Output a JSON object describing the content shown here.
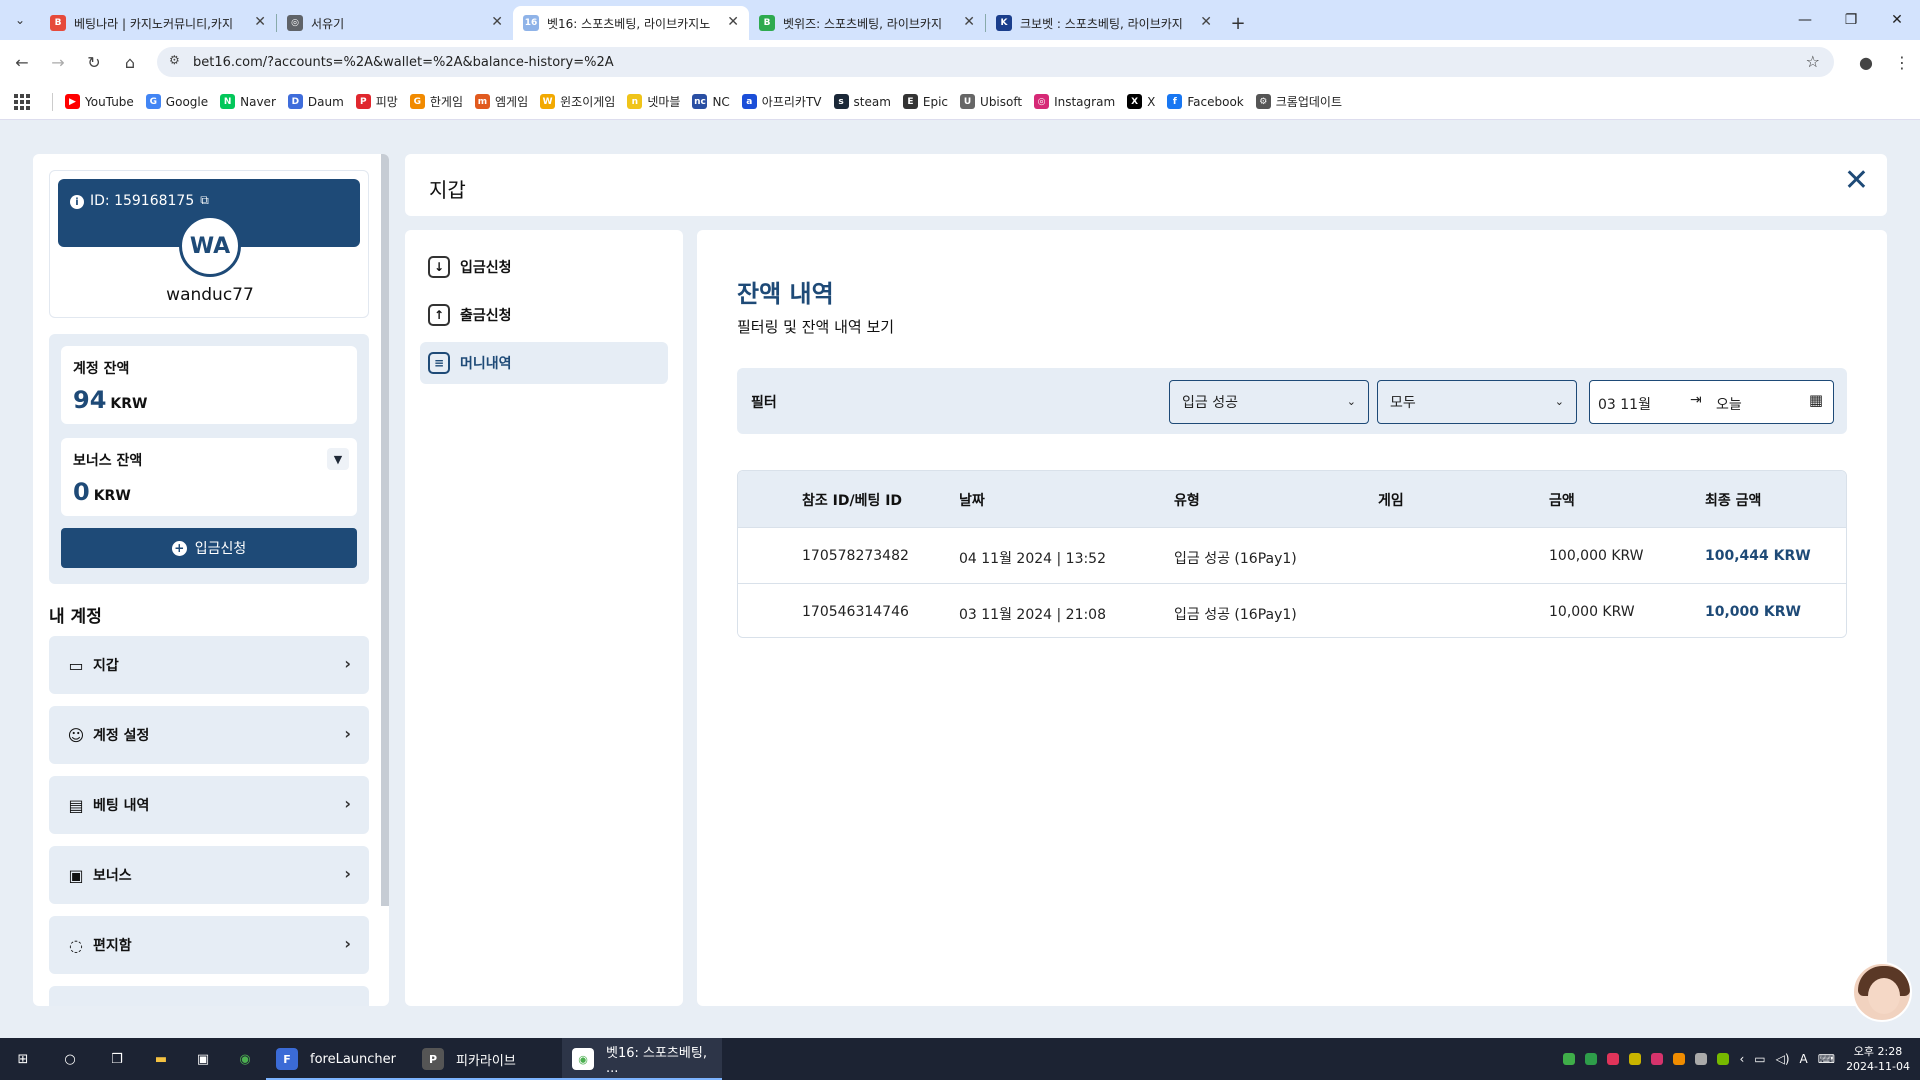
{
  "browser": {
    "tabs": [
      {
        "label": "베팅나라 | 카지노커뮤니티,카지",
        "fav": "B",
        "fav_color": "#e64a3b",
        "active": false
      },
      {
        "label": "서유기",
        "fav": "◎",
        "fav_color": "#5f6368",
        "active": false
      },
      {
        "label": "벳16: 스포츠베팅, 라이브카지노",
        "fav": "16",
        "fav_color": "#8fb3e8",
        "active": true
      },
      {
        "label": "벳위즈: 스포츠베팅, 라이브카지",
        "fav": "B",
        "fav_color": "#2eaa4f",
        "active": false
      },
      {
        "label": "크보벳 : 스포츠베팅, 라이브카지",
        "fav": "K",
        "fav_color": "#1a3e8c",
        "active": false
      }
    ],
    "url": "bet16.com/?accounts=%2A&wallet=%2A&balance-history=%2A",
    "bookmarks": [
      {
        "label": "YouTube",
        "icon": "▶",
        "color": "#ff0000"
      },
      {
        "label": "Google",
        "icon": "G",
        "color": "#4285f4"
      },
      {
        "label": "Naver",
        "icon": "N",
        "color": "#03c75a"
      },
      {
        "label": "Daum",
        "icon": "D",
        "color": "#3f6ddb"
      },
      {
        "label": "피망",
        "icon": "P",
        "color": "#e0272e"
      },
      {
        "label": "한게임",
        "icon": "G",
        "color": "#f18a00"
      },
      {
        "label": "엠게임",
        "icon": "m",
        "color": "#e15a1f"
      },
      {
        "label": "윈조이게임",
        "icon": "W",
        "color": "#f2a900"
      },
      {
        "label": "넷마블",
        "icon": "n",
        "color": "#f0c419"
      },
      {
        "label": "NC",
        "icon": "nc",
        "color": "#2a4fa3"
      },
      {
        "label": "아프리카TV",
        "icon": "a",
        "color": "#1b4ed8"
      },
      {
        "label": "steam",
        "icon": "s",
        "color": "#1b2838"
      },
      {
        "label": "Epic",
        "icon": "E",
        "color": "#333333"
      },
      {
        "label": "Ubisoft",
        "icon": "U",
        "color": "#666666"
      },
      {
        "label": "Instagram",
        "icon": "◎",
        "color": "#d62976"
      },
      {
        "label": "X",
        "icon": "X",
        "color": "#000000"
      },
      {
        "label": "Facebook",
        "icon": "f",
        "color": "#1877f2"
      },
      {
        "label": "크롬업데이트",
        "icon": "⚙",
        "color": "#555555"
      }
    ]
  },
  "profile": {
    "id_label": "ID: 159168175",
    "initials": "WA",
    "username": "wanduc77"
  },
  "balances": {
    "account_label": "계정 잔액",
    "account_value": "94",
    "account_currency": "KRW",
    "bonus_label": "보너스 잔액",
    "bonus_value": "0",
    "bonus_currency": "KRW",
    "deposit_button": "입금신청"
  },
  "my_account": {
    "heading": "내 계정",
    "items": [
      {
        "label": "지갑",
        "icon": "wallet-icon"
      },
      {
        "label": "계정 설정",
        "icon": "user-settings-icon"
      },
      {
        "label": "베팅 내역",
        "icon": "receipt-icon"
      },
      {
        "label": "보너스",
        "icon": "gift-icon"
      },
      {
        "label": "편지함",
        "icon": "chat-icon"
      }
    ]
  },
  "wallet": {
    "title": "지갑",
    "nav": [
      {
        "label": "입금신청",
        "icon": "download-icon"
      },
      {
        "label": "출금신청",
        "icon": "upload-icon"
      },
      {
        "label": "머니내역",
        "icon": "document-icon",
        "active": true
      }
    ]
  },
  "history": {
    "title": "잔액 내역",
    "subtitle": "필터링 및 잔액 내역 보기",
    "filter_label": "필터",
    "type_select": "입금 성공",
    "game_select": "모두",
    "date_from": "03 11월",
    "date_to": "오늘",
    "columns": [
      "참조 ID/베팅 ID",
      "날짜",
      "유형",
      "게임",
      "금액",
      "최종 금액"
    ],
    "rows": [
      {
        "ref": "170578273482",
        "date": "04 11월 2024 | 13:52",
        "type": "입금 성공 (16Pay1)",
        "game": "",
        "amount": "100,000 KRW",
        "final": "100,444 KRW"
      },
      {
        "ref": "170546314746",
        "date": "03 11월 2024 | 21:08",
        "type": "입금 성공 (16Pay1)",
        "game": "",
        "amount": "10,000 KRW",
        "final": "10,000 KRW"
      }
    ]
  },
  "taskbar": {
    "apps": [
      {
        "label": "foreLauncher",
        "icon": "F",
        "color": "#3b6bd6"
      },
      {
        "label": "피카라이브",
        "icon": "P",
        "color": "#444"
      },
      {
        "label": "벳16: 스포츠베팅, ...",
        "icon": "●",
        "color": "#fff",
        "active": true
      }
    ],
    "time": "오후 2:28",
    "date": "2024-11-04"
  },
  "colors": {
    "accent": "#1e4a77",
    "panel": "#e6edf5"
  }
}
